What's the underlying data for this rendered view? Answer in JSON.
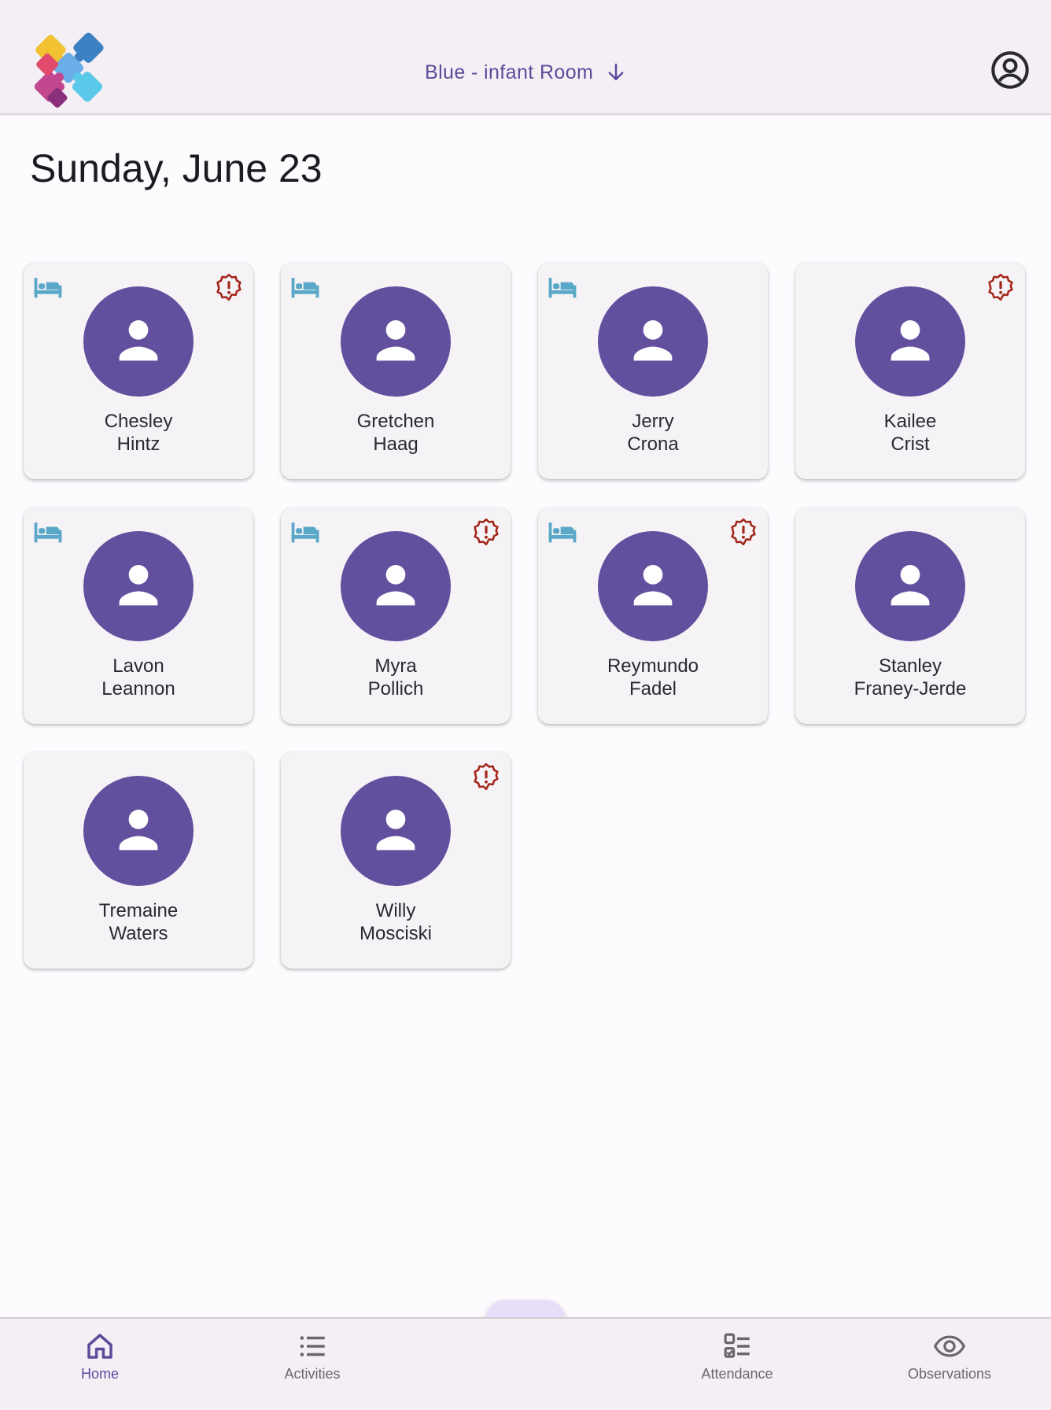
{
  "header": {
    "room_label": "Blue - infant Room",
    "logo_icon": "puzzle-logo-icon",
    "account_icon": "account-circle-icon",
    "room_dropdown_icon": "arrow-down-icon"
  },
  "page": {
    "date_title": "Sunday, June 23"
  },
  "children": [
    {
      "first": "Chesley",
      "last": "Hintz",
      "sleeping": true,
      "alert": true
    },
    {
      "first": "Gretchen",
      "last": "Haag",
      "sleeping": true,
      "alert": false
    },
    {
      "first": "Jerry",
      "last": "Crona",
      "sleeping": true,
      "alert": false
    },
    {
      "first": "Kailee",
      "last": "Crist",
      "sleeping": false,
      "alert": true
    },
    {
      "first": "Lavon",
      "last": "Leannon",
      "sleeping": true,
      "alert": false
    },
    {
      "first": "Myra",
      "last": "Pollich",
      "sleeping": true,
      "alert": true
    },
    {
      "first": "Reymundo",
      "last": "Fadel",
      "sleeping": true,
      "alert": true
    },
    {
      "first": "Stanley",
      "last": "Franey-Jerde",
      "sleeping": false,
      "alert": false
    },
    {
      "first": "Tremaine",
      "last": "Waters",
      "sleeping": false,
      "alert": false
    },
    {
      "first": "Willy",
      "last": "Mosciski",
      "sleeping": false,
      "alert": true
    }
  ],
  "nav": {
    "home": "Home",
    "activities": "Activities",
    "attendance": "Attendance",
    "observations": "Observations",
    "active": "home"
  },
  "colors": {
    "accent": "#5c4b9a",
    "avatar": "#624f9e",
    "sleep_icon": "#5aa8c8",
    "alert_icon": "#a42418",
    "fab_background": "#e8defa"
  }
}
